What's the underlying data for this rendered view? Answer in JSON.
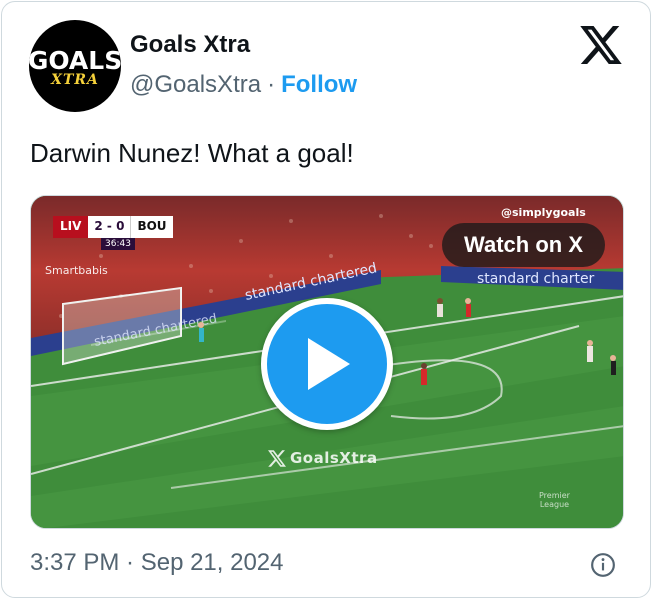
{
  "author": {
    "avatar_line1": "GOALS",
    "avatar_line2": "XTRA",
    "name": "Goals Xtra",
    "handle": "@GoalsXtra",
    "separator": "·",
    "follow_label": "Follow"
  },
  "platform_icon": "x-logo-icon",
  "tweet_text": "Darwin Nunez! What a goal!",
  "media": {
    "scorebug": {
      "home": "LIV",
      "score": "2 - 0",
      "away": "BOU",
      "clock": "36:43"
    },
    "sponsor_overlay": "Smartbabis",
    "credit_overlay": "@simplygoals",
    "board_text_1": "standard chartered",
    "board_text_2": "standard chartered",
    "board_text_3": "standard charter",
    "watch_label": "Watch on X",
    "play_icon": "play-icon",
    "watermark": "GoalsXtra",
    "league_badge_line1": "Premier",
    "league_badge_line2": "League"
  },
  "timestamp": "3:37 PM · Sep 21, 2024",
  "info_icon": "info-icon",
  "colors": {
    "accent": "#1d9bf0",
    "text": "#0f1419",
    "secondary": "#536471",
    "border": "#cfd9de"
  }
}
